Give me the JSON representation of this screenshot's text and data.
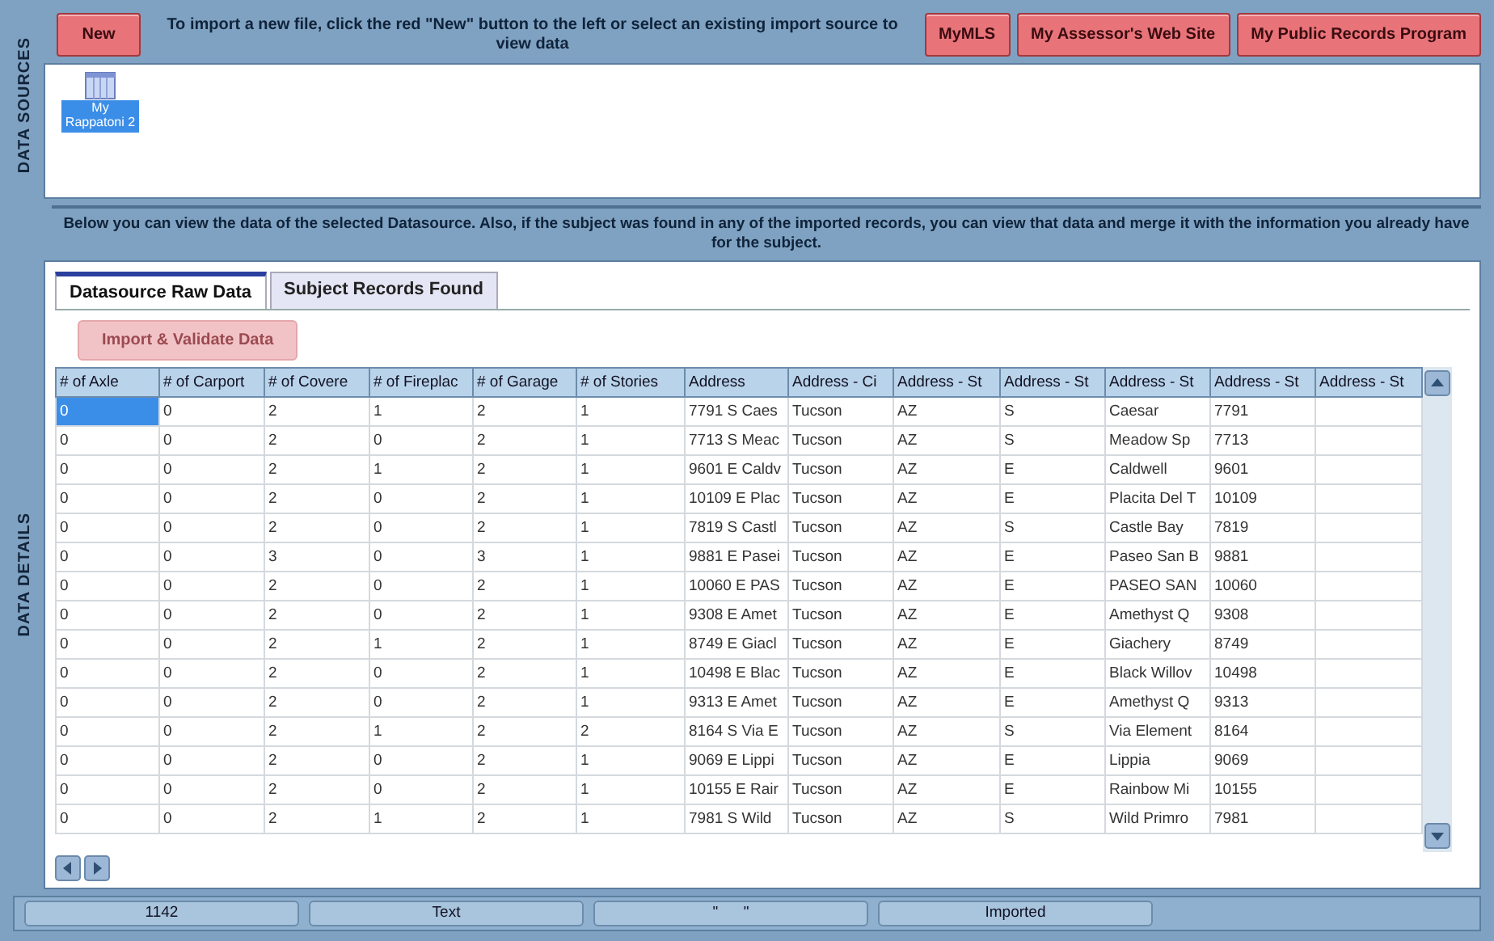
{
  "data_sources": {
    "side_label": "DATA SOURCES",
    "new_button": "New",
    "instructions": "To import a new file, click the red \"New\" button to the left or select an existing import source to view data",
    "link_buttons": [
      "MyMLS",
      "My Assessor's Web Site",
      "My Public Records Program"
    ],
    "items": [
      {
        "label": "My Rappatoni 2",
        "selected": true
      }
    ]
  },
  "description": "Below you can view the data of the selected Datasource.  Also, if the subject was found in any of the imported records, you can view that data and merge it with the information you already have for the subject.",
  "data_details": {
    "side_label": "DATA DETAILS",
    "tabs": [
      {
        "label": "Datasource Raw Data",
        "selected": true
      },
      {
        "label": "Subject Records Found",
        "selected": false
      }
    ],
    "import_button": {
      "label": "Import & Validate Data",
      "disabled": true
    },
    "table": {
      "columns": [
        "# of Axle",
        "# of Carport",
        "# of Covere",
        "# of Fireplac",
        "# of Garage",
        "# of Stories",
        "Address",
        "Address - Ci",
        "Address - St",
        "Address - St",
        "Address - St",
        "Address - St",
        "Address - St"
      ],
      "rows": [
        {
          "selected": true,
          "cells": [
            "0",
            "0",
            "2",
            "1",
            "2",
            "1",
            "7791 S Caes",
            "Tucson",
            "AZ",
            "S",
            "Caesar",
            "7791"
          ]
        },
        {
          "selected": false,
          "cells": [
            "0",
            "0",
            "2",
            "0",
            "2",
            "1",
            "7713 S Meac",
            "Tucson",
            "AZ",
            "S",
            "Meadow Sp",
            "7713"
          ]
        },
        {
          "selected": false,
          "cells": [
            "0",
            "0",
            "2",
            "1",
            "2",
            "1",
            "9601 E Caldv",
            "Tucson",
            "AZ",
            "E",
            "Caldwell",
            "9601"
          ]
        },
        {
          "selected": false,
          "cells": [
            "0",
            "0",
            "2",
            "0",
            "2",
            "1",
            "10109 E Plac",
            "Tucson",
            "AZ",
            "E",
            "Placita Del T",
            "10109"
          ]
        },
        {
          "selected": false,
          "cells": [
            "0",
            "0",
            "2",
            "0",
            "2",
            "1",
            "7819 S Castl",
            "Tucson",
            "AZ",
            "S",
            "Castle Bay",
            "7819"
          ]
        },
        {
          "selected": false,
          "cells": [
            "0",
            "0",
            "3",
            "0",
            "3",
            "1",
            "9881 E Pasei",
            "Tucson",
            "AZ",
            "E",
            "Paseo San B",
            "9881"
          ]
        },
        {
          "selected": false,
          "cells": [
            "0",
            "0",
            "2",
            "0",
            "2",
            "1",
            "10060 E PAS",
            "Tucson",
            "AZ",
            "E",
            "PASEO SAN",
            "10060"
          ]
        },
        {
          "selected": false,
          "cells": [
            "0",
            "0",
            "2",
            "0",
            "2",
            "1",
            "9308 E Amet",
            "Tucson",
            "AZ",
            "E",
            "Amethyst Q",
            "9308"
          ]
        },
        {
          "selected": false,
          "cells": [
            "0",
            "0",
            "2",
            "1",
            "2",
            "1",
            "8749 E Giacl",
            "Tucson",
            "AZ",
            "E",
            "Giachery",
            "8749"
          ]
        },
        {
          "selected": false,
          "cells": [
            "0",
            "0",
            "2",
            "0",
            "2",
            "1",
            "10498 E Blac",
            "Tucson",
            "AZ",
            "E",
            "Black Willov",
            "10498"
          ]
        },
        {
          "selected": false,
          "cells": [
            "0",
            "0",
            "2",
            "0",
            "2",
            "1",
            "9313 E Amet",
            "Tucson",
            "AZ",
            "E",
            "Amethyst Q",
            "9313"
          ]
        },
        {
          "selected": false,
          "cells": [
            "0",
            "0",
            "2",
            "1",
            "2",
            "2",
            "8164 S Via E",
            "Tucson",
            "AZ",
            "S",
            "Via Element",
            "8164"
          ]
        },
        {
          "selected": false,
          "cells": [
            "0",
            "0",
            "2",
            "0",
            "2",
            "1",
            "9069 E Lippi",
            "Tucson",
            "AZ",
            "E",
            "Lippia",
            "9069"
          ]
        },
        {
          "selected": false,
          "cells": [
            "0",
            "0",
            "2",
            "0",
            "2",
            "1",
            "10155 E Rair",
            "Tucson",
            "AZ",
            "E",
            "Rainbow Mi",
            "10155"
          ]
        },
        {
          "selected": false,
          "cells": [
            "0",
            "0",
            "2",
            "1",
            "2",
            "1",
            "7981 S Wild",
            "Tucson",
            "AZ",
            "S",
            "Wild Primro",
            "7981"
          ]
        }
      ]
    }
  },
  "status_bar": [
    "1142",
    "Text",
    "\"      \"",
    "Imported"
  ]
}
